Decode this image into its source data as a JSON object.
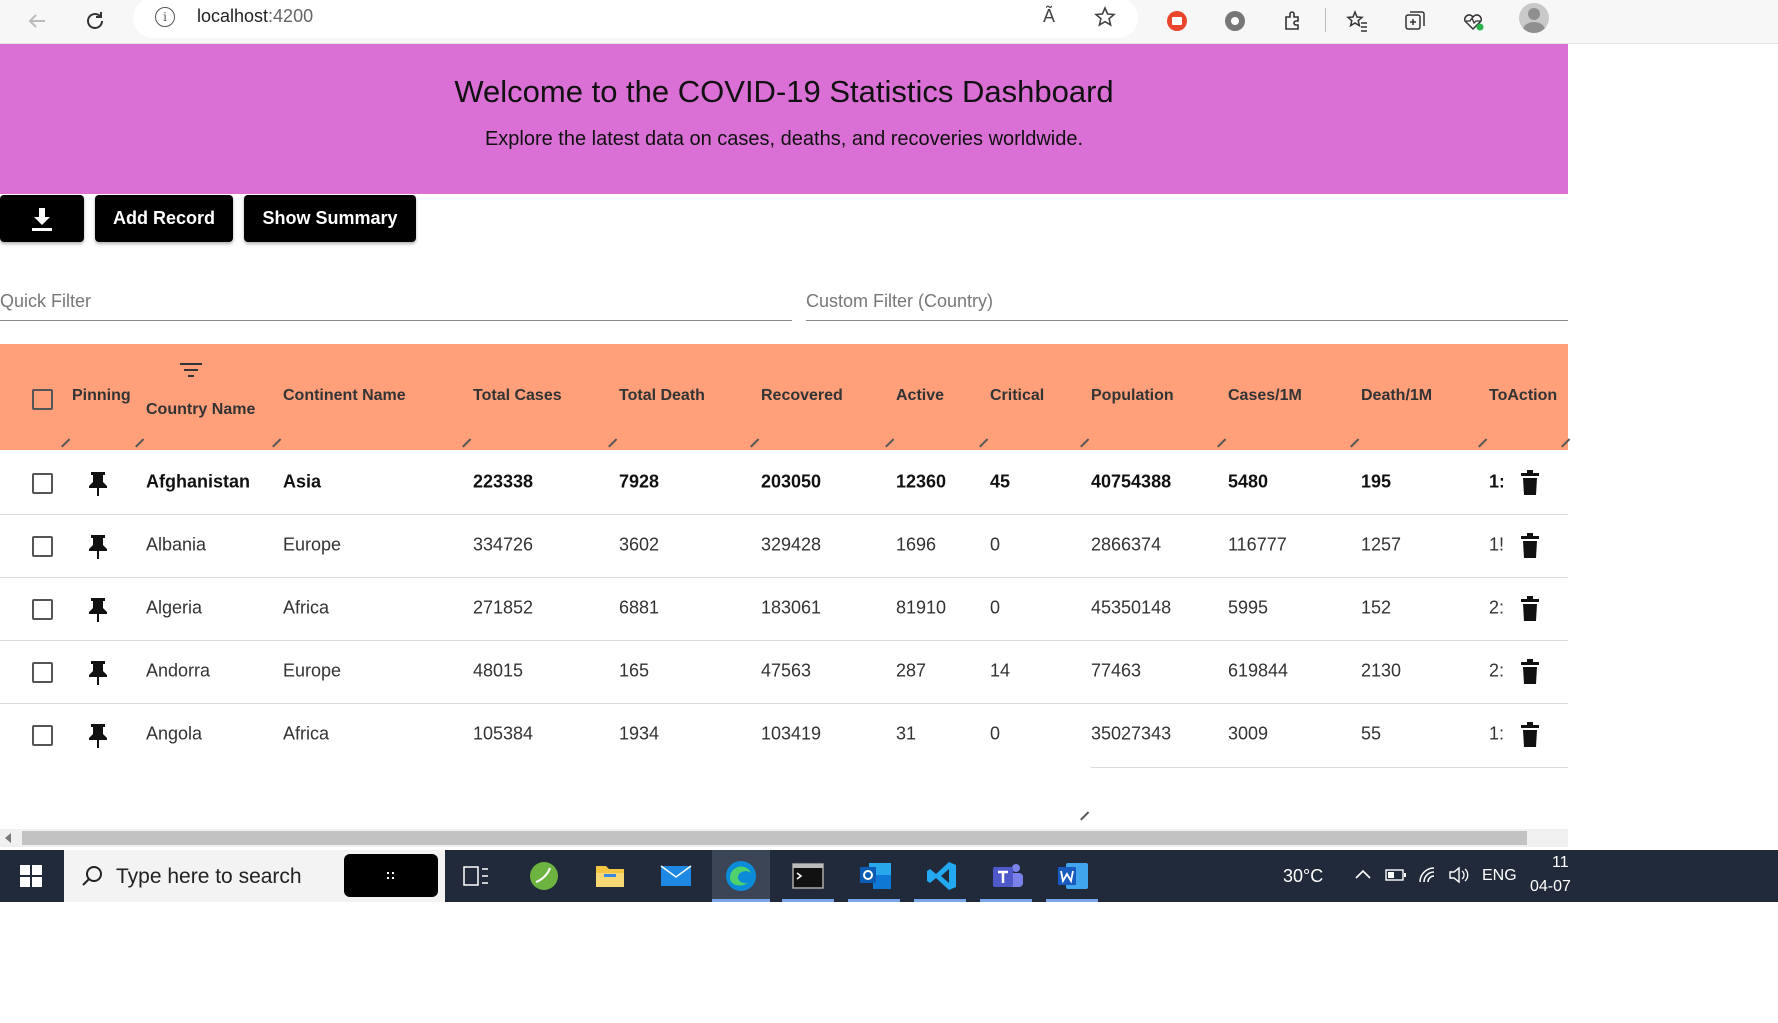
{
  "browser": {
    "url_host": "localhost",
    "url_port": ":4200",
    "info_glyph": "i",
    "read_aloud_glyph": "Ã"
  },
  "banner": {
    "title": "Welcome to the COVID-19 Statistics Dashboard",
    "subtitle": "Explore the latest data on cases, deaths, and recoveries worldwide.",
    "color": "#da70d6"
  },
  "actions": {
    "download_icon": "download-icon",
    "add_record_label": "Add Record",
    "show_summary_label": "Show Summary"
  },
  "filters": {
    "quick_placeholder": "Quick Filter",
    "custom_placeholder": "Custom Filter (Country)"
  },
  "grid": {
    "header_color": "#ffa07a",
    "columns": {
      "pinning": "Pinning",
      "country": "Country Name",
      "continent": "Continent Name",
      "total_cases": "Total Cases",
      "total_death": "Total Death",
      "recovered": "Recovered",
      "active": "Active",
      "critical": "Critical",
      "population": "Population",
      "cases_per_1m": "Cases/1M",
      "death_per_1m": "Death/1M",
      "to_action": "ToAction"
    },
    "rows": [
      {
        "country": "Afghanistan",
        "continent": "Asia",
        "total_cases": "223338",
        "total_death": "7928",
        "recovered": "203050",
        "active": "12360",
        "critical": "45",
        "population": "40754388",
        "cases_per_1m": "5480",
        "death_per_1m": "195",
        "truncated": "1:"
      },
      {
        "country": "Albania",
        "continent": "Europe",
        "total_cases": "334726",
        "total_death": "3602",
        "recovered": "329428",
        "active": "1696",
        "critical": "0",
        "population": "2866374",
        "cases_per_1m": "116777",
        "death_per_1m": "1257",
        "truncated": "1!"
      },
      {
        "country": "Algeria",
        "continent": "Africa",
        "total_cases": "271852",
        "total_death": "6881",
        "recovered": "183061",
        "active": "81910",
        "critical": "0",
        "population": "45350148",
        "cases_per_1m": "5995",
        "death_per_1m": "152",
        "truncated": "2:"
      },
      {
        "country": "Andorra",
        "continent": "Europe",
        "total_cases": "48015",
        "total_death": "165",
        "recovered": "47563",
        "active": "287",
        "critical": "14",
        "population": "77463",
        "cases_per_1m": "619844",
        "death_per_1m": "2130",
        "truncated": "2:"
      },
      {
        "country": "Angola",
        "continent": "Africa",
        "total_cases": "105384",
        "total_death": "1934",
        "recovered": "103419",
        "active": "31",
        "critical": "0",
        "population": "35027343",
        "cases_per_1m": "3009",
        "death_per_1m": "55",
        "truncated": "1:"
      }
    ]
  },
  "taskbar": {
    "search_placeholder": "Type here to search",
    "weather": "30°C",
    "language": "ENG",
    "time": "11",
    "date": "04-07"
  }
}
